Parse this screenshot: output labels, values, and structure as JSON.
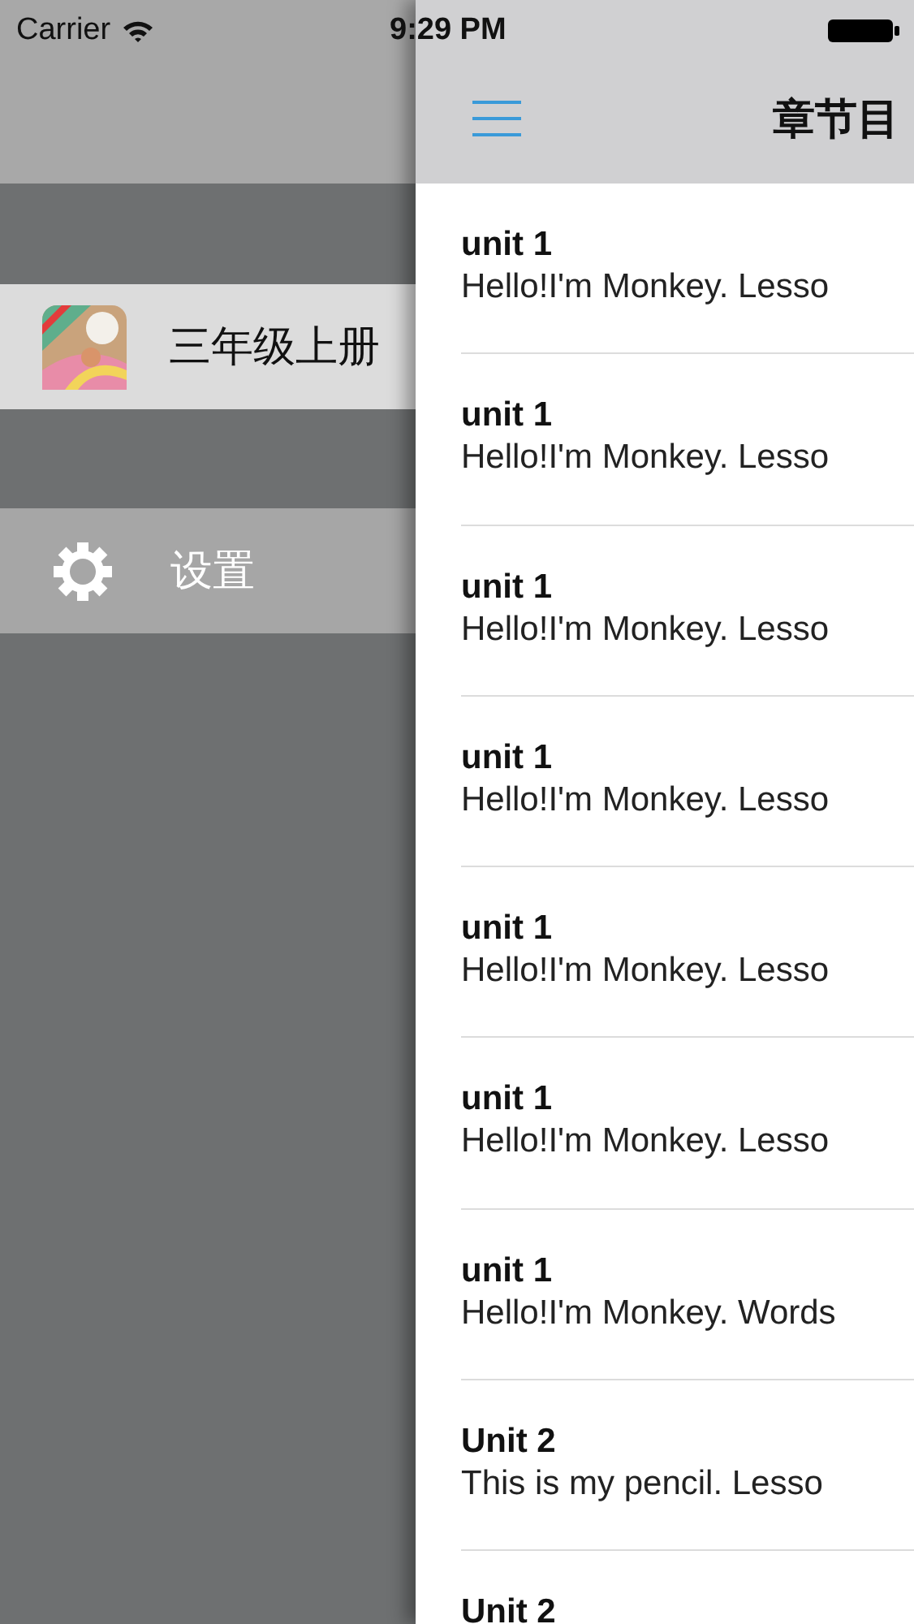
{
  "status_bar": {
    "carrier": "Carrier",
    "time": "9:29 PM"
  },
  "sidebar": {
    "items": [
      {
        "kind": "book",
        "label": "三年级上册"
      },
      {
        "kind": "settings",
        "label": "设置"
      }
    ]
  },
  "nav_bar": {
    "title": "章节目"
  },
  "rows": [
    {
      "title": "unit 1",
      "subtitle": "Hello!I'm Monkey. Lesso"
    },
    {
      "title": "unit 1",
      "subtitle": "Hello!I'm Monkey. Lesso"
    },
    {
      "title": "unit 1",
      "subtitle": "Hello!I'm Monkey. Lesso"
    },
    {
      "title": "unit 1",
      "subtitle": "Hello!I'm Monkey. Lesso"
    },
    {
      "title": "unit 1",
      "subtitle": "Hello!I'm Monkey. Lesso"
    },
    {
      "title": "unit 1",
      "subtitle": "Hello!I'm Monkey. Lesso"
    },
    {
      "title": "unit 1",
      "subtitle": "Hello!I'm Monkey. Words"
    },
    {
      "title": "Unit 2",
      "subtitle": "This is my pencil. Lesso"
    },
    {
      "title": "Unit 2"
    }
  ]
}
